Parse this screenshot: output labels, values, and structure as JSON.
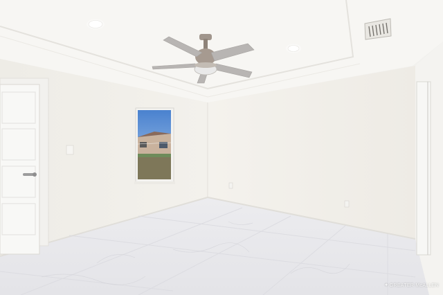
{
  "photo": {
    "subject": "empty room",
    "watermark_text": "GREATER McALLEN",
    "colors": {
      "wall": "#f1efea",
      "ceiling": "#f6f5f2",
      "floor": "#e9e9ec",
      "fan_metal": "#9a8f86",
      "door": "#f7f7f5",
      "sky": "#5b8fd3"
    }
  }
}
